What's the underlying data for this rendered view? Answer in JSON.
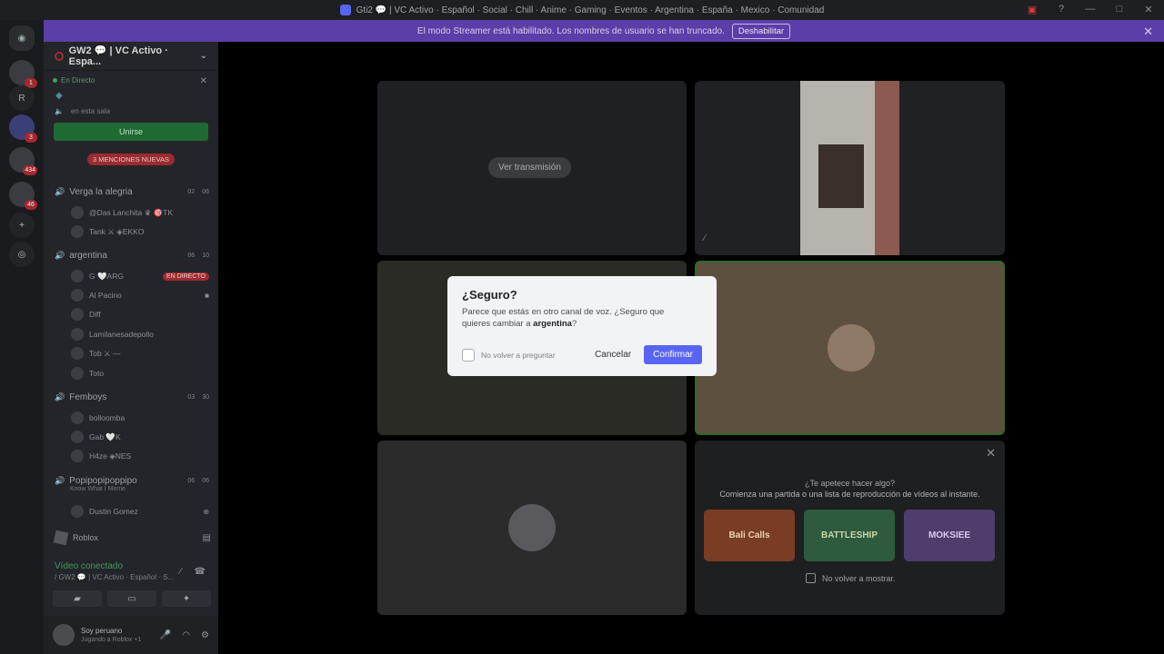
{
  "window": {
    "title": "Gti2 💬 | VC Activo · Español · Social · Chill · Anime · Gaming · Eventos · Argentina · España · Mexico · Comunidad"
  },
  "banner": {
    "text": "El modo Streamer está habilitado. Los nombres de usuario se han truncado.",
    "button": "Deshabilitar"
  },
  "rail": {
    "badges": [
      "1",
      "3",
      "434",
      "46"
    ]
  },
  "sidebar": {
    "server_name": "GW2 💬 | VC Activo · Espa...",
    "live_label": "En Directo",
    "in_channel": "en esta sala",
    "join_button": "Unirse",
    "mentions_badge": "3 MENCIONES NUEVAS",
    "channels": [
      {
        "name": "Verga la alegria",
        "count_a": "02",
        "count_b": "06",
        "users": [
          "@Das Lanchita ♛ 🎯TK",
          "Tank ⚔ ◈EKKO"
        ]
      },
      {
        "name": "argentina",
        "count_a": "06",
        "count_b": "10",
        "users": [
          "G 🤍ARG",
          "Al Pacino",
          "Diff",
          "Lamilanesadepollo",
          "Tob ⚔ —",
          "Toto"
        ],
        "live_tag": "EN DIRECTO"
      },
      {
        "name": "Femboys",
        "count_a": "03",
        "count_b": "30",
        "users": [
          "bolloomba",
          "Gab 🤍K",
          "H4ze ◈NES"
        ]
      },
      {
        "name": "Popipopipoppipo",
        "count_a": "06",
        "count_b": "06",
        "subtitle": "Know What I Meme",
        "users": [
          "Dustin Gomez"
        ]
      }
    ],
    "activity": "Roblox",
    "voice_status": "Vídeo conectado",
    "voice_channel": "/ GW2 💬 | VC Activo · Español · S...",
    "user": {
      "name": "Soy peruano",
      "status": "Jugando a Roblox +1"
    }
  },
  "stage": {
    "watch_stream": "Ver transmisión",
    "activity_question": "¿Te apetece hacer algo?",
    "activity_desc": "Comienza una partida o una lista de reproducción de vídeos al instante.",
    "games": [
      "Bali Calls",
      "BATTLESHIP",
      "MOKSIEE"
    ],
    "dont_show": "No volver a mostrar."
  },
  "modal": {
    "title": "¿Seguro?",
    "body_prefix": "Parece que estás en otro canal de voz. ¿Seguro que quieres cambiar a ",
    "body_channel": "argentina",
    "body_suffix": "?",
    "dont_ask": "No volver a preguntar",
    "cancel": "Cancelar",
    "confirm": "Confirmar"
  }
}
